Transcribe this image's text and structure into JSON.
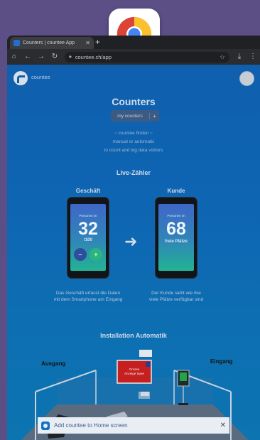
{
  "browser": {
    "tab_title": "Counters | countee App",
    "tab_close": "✕",
    "new_tab": "+",
    "url": "countee.ch/app",
    "icons": [
      "home-icon",
      "back-icon",
      "forward-icon",
      "reload-icon",
      "lock-icon",
      "star-icon",
      "download-icon",
      "menu-icon"
    ]
  },
  "app": {
    "logo_text": "countee",
    "title": "Counters",
    "my_counters_label": "my counters",
    "add_label": "+",
    "intro": [
      "~ countee finden ~",
      "manual or automatic",
      "to count and log data visitors"
    ],
    "live_title": "Live-Zähler",
    "shop_title": "Geschäft",
    "customer_title": "Kunde",
    "shop_phone": {
      "caption": "Personen im",
      "count": "32",
      "max": "/100",
      "minus": "–",
      "plus": "+"
    },
    "customer_phone": {
      "caption": "Personen im",
      "count": "68",
      "sub": "freie Plätze"
    },
    "shop_caption": [
      "Das Geschäft erfasst die Daten",
      "mit dem Smartphone am Eingang"
    ],
    "customer_caption": [
      "Der Kunde sieht wie live",
      "viele Plätze verfügbar sind"
    ],
    "install_title": "Installation Automatik",
    "exit_label": "Ausgang",
    "entry_label": "Eingang",
    "sign_text": [
      "Grosse",
      "Anzeige Spee"
    ]
  },
  "banner": {
    "text": "Add countee to Home screen",
    "close": "✕"
  },
  "colors": {
    "page_top": "#0f5fae",
    "page_bottom": "#0c74b0",
    "desktop": "#5b4f86"
  }
}
